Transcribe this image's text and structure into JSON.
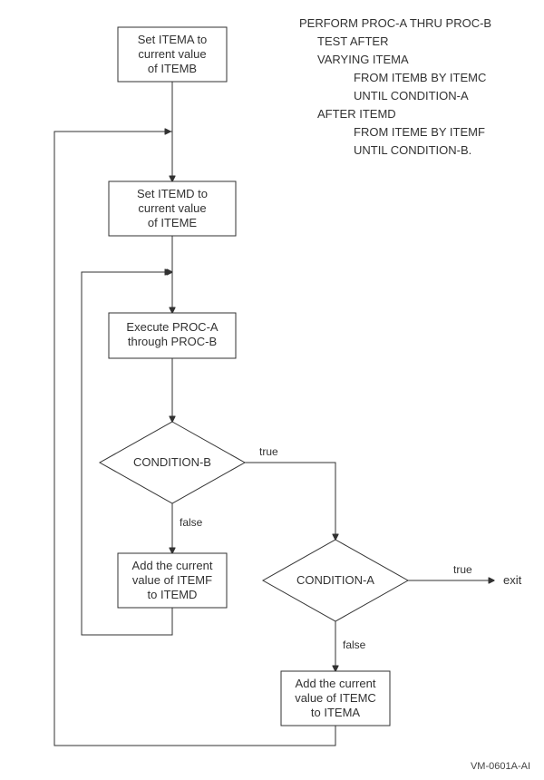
{
  "boxes": {
    "b1_l1": "Set ITEMA to",
    "b1_l2": "current value",
    "b1_l3": "of ITEMB",
    "b2_l1": "Set ITEMD to",
    "b2_l2": "current value",
    "b2_l3": "of ITEME",
    "b3_l1": "Execute PROC-A",
    "b3_l2": "through PROC-B",
    "b4_l1": "Add the current",
    "b4_l2": "value of ITEMF",
    "b4_l3": "to ITEMD",
    "b5_l1": "Add the current",
    "b5_l2": "value of ITEMC",
    "b5_l3": "to ITEMA"
  },
  "diamonds": {
    "d1": "CONDITION-B",
    "d2": "CONDITION-A"
  },
  "labels": {
    "true": "true",
    "false": "false",
    "exit": "exit"
  },
  "code": {
    "l1": "PERFORM PROC-A THRU PROC-B",
    "l2": "TEST AFTER",
    "l3": "VARYING ITEMA",
    "l4": "FROM ITEMB BY ITEMC",
    "l5": "UNTIL CONDITION-A",
    "l6": "AFTER ITEMD",
    "l7": "FROM ITEME BY ITEMF",
    "l8": "UNTIL CONDITION-B."
  },
  "figure_id": "VM-0601A-AI"
}
